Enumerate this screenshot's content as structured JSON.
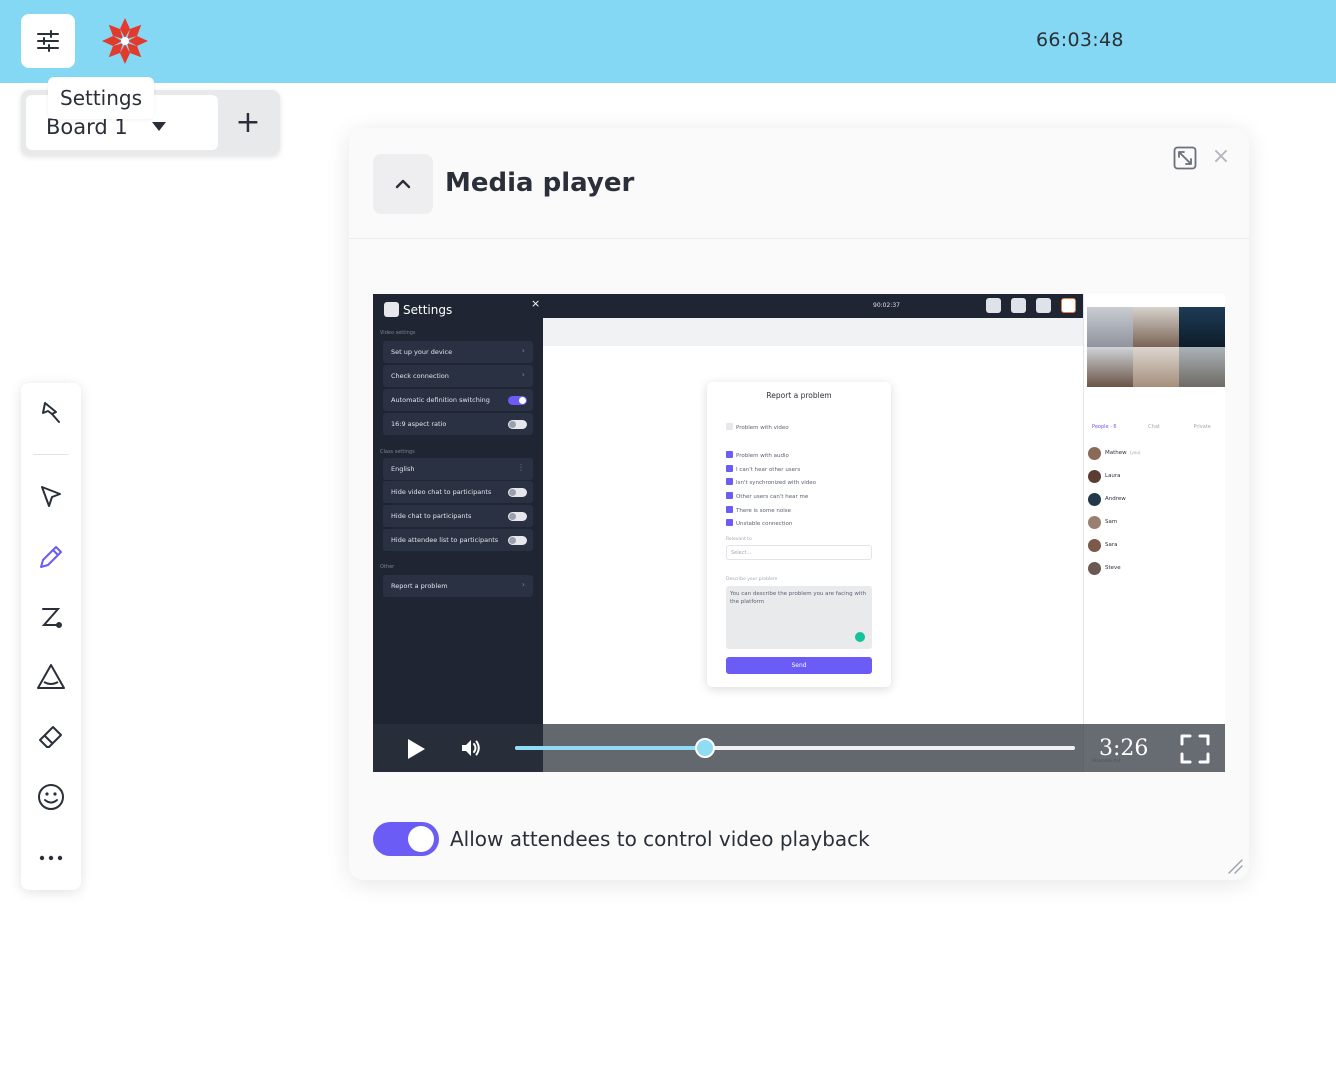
{
  "topbar": {
    "timer": "66:03:48",
    "settings_tooltip": "Settings"
  },
  "board": {
    "selected": "Board 1",
    "add_label": "+"
  },
  "toolbar": {
    "tools": [
      "pin-icon",
      "cursor-icon",
      "pencil-icon",
      "connector-icon",
      "shape-icon",
      "eraser-icon",
      "emoji-icon",
      "more-icon"
    ],
    "active_tool": "pencil-icon"
  },
  "panel": {
    "title": "Media player",
    "close_label": "×",
    "allow_label": "Allow attendees to control video playback",
    "allow_enabled": true
  },
  "video": {
    "duration": "3:26",
    "progress": 0.34,
    "frame": {
      "sidebar_title": "Settings",
      "sidebar_close": "×",
      "group_video": "Video settings",
      "video_rows": [
        {
          "label": "Set up your device",
          "kind": "chevron"
        },
        {
          "label": "Check connection",
          "kind": "chevron"
        },
        {
          "label": "Automatic definition switching",
          "kind": "toggle-on"
        },
        {
          "label": "16:9 aspect ratio",
          "kind": "toggle-off"
        }
      ],
      "group_class": "Class settings",
      "class_rows": [
        {
          "label": "English",
          "kind": "chevron"
        },
        {
          "label": "Hide video chat to participants",
          "kind": "toggle-off"
        },
        {
          "label": "Hide chat to participants",
          "kind": "toggle-off"
        },
        {
          "label": "Hide attendee list to participants",
          "kind": "toggle-off"
        }
      ],
      "group_other": "Other",
      "other_rows": [
        {
          "label": "Report a problem",
          "kind": "chevron"
        }
      ],
      "time": "90:02:37",
      "dialog": {
        "title": "Report a problem",
        "problem_video": "Problem with video",
        "problem_audio": "Problem with audio",
        "checks": [
          "I can't hear other users",
          "Isn't synchronized with video",
          "Other users can't hear me",
          "There is some noise",
          "Unstable connection"
        ],
        "relevant_label": "Relevant to",
        "select_placeholder": "Select...",
        "describe_label": "Describe your problem",
        "textarea": "You can describe the problem you are facing with the platform",
        "send": "Send"
      },
      "tabs": [
        "People · 6",
        "Chat",
        "Private"
      ],
      "people": [
        "Mathew",
        "Laura",
        "Andrew",
        "Sam",
        "Sara",
        "Steve"
      ],
      "you_tag": "(you)",
      "attendee_list": "Attendee list"
    }
  },
  "colors": {
    "topbar": "#85d8f3",
    "accent": "#6a5cf5",
    "seek": "#8fdcf3"
  }
}
